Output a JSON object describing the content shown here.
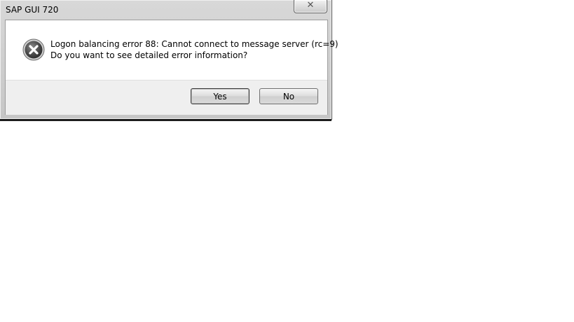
{
  "window": {
    "title": "SAP GUI 720",
    "close_label": "✕"
  },
  "message": {
    "icon": "error-icon",
    "line1": "Logon balancing error 88: Cannot connect to message server (rc=9)",
    "line2": "Do you want to see detailed error information?"
  },
  "buttons": {
    "yes": "Yes",
    "no": "No"
  },
  "colors": {
    "error_icon": "#3c3c3c"
  }
}
